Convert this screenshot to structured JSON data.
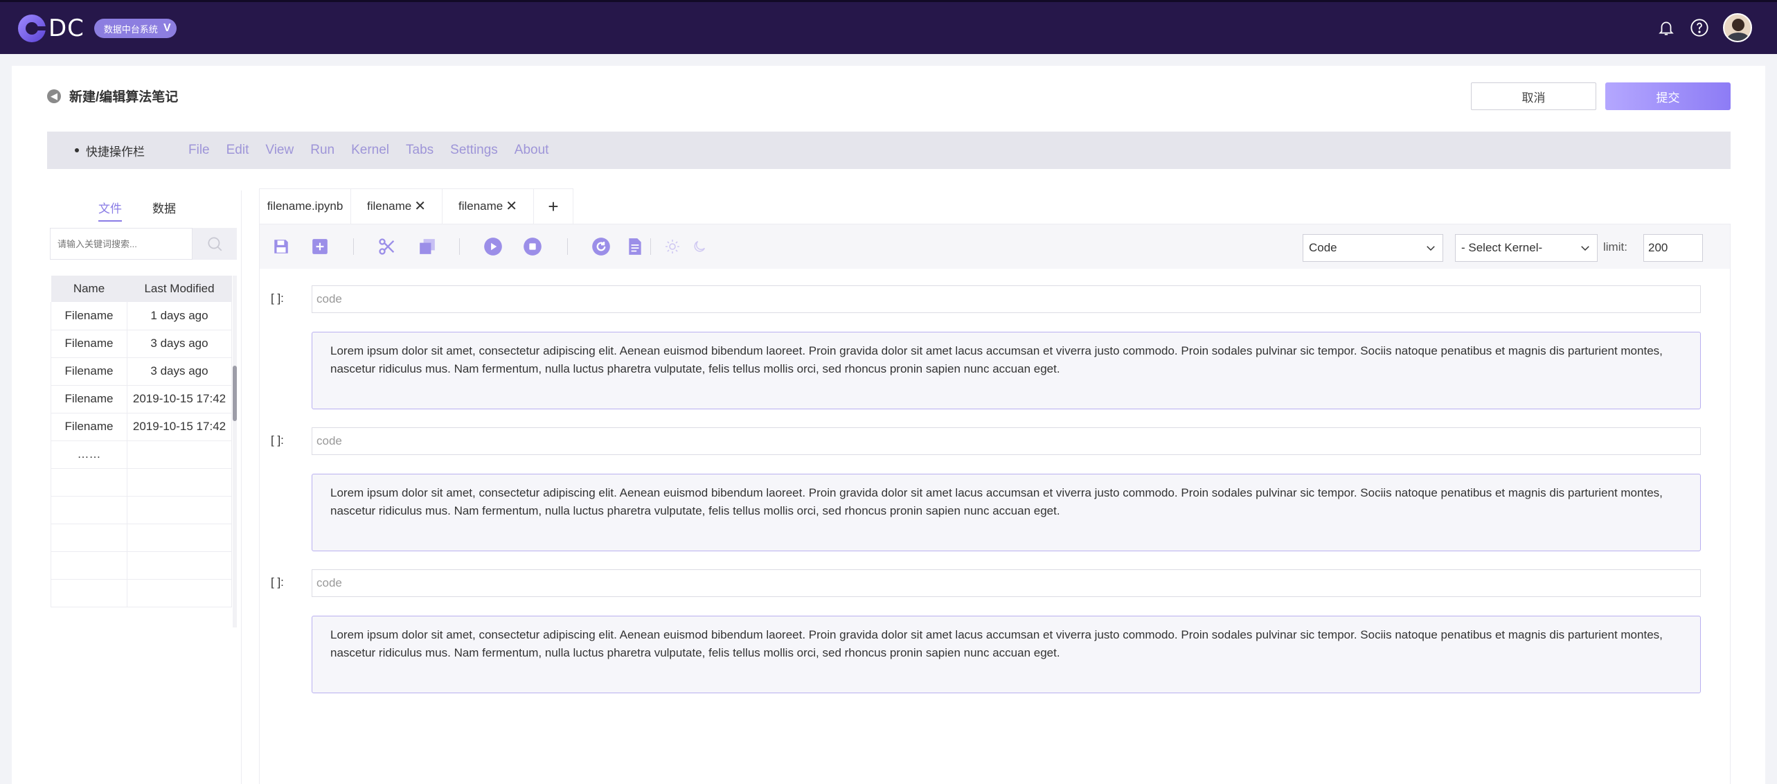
{
  "header": {
    "logo_text": "DC",
    "system_label": "数据中台系统",
    "icons": [
      "bell-icon",
      "help-icon",
      "avatar"
    ]
  },
  "page": {
    "title": "新建/编辑算法笔记",
    "cancel_label": "取消",
    "submit_label": "提交"
  },
  "quickbar": {
    "label": "快捷操作栏",
    "menu": [
      "File",
      "Edit",
      "View",
      "Run",
      "Kernel",
      "Tabs",
      "Settings",
      "About"
    ]
  },
  "left_panel": {
    "tabs": [
      "文件",
      "数据"
    ],
    "active_tab": "文件",
    "search_placeholder": "请输入关键词搜索...",
    "columns": [
      "Name",
      "Last Modified"
    ],
    "rows": [
      [
        "Filename",
        "1 days ago"
      ],
      [
        "Filename",
        "3 days ago"
      ],
      [
        "Filename",
        "3 days ago"
      ],
      [
        "Filename",
        "2019-10-15 17:42"
      ],
      [
        "Filename",
        "2019-10-15 17:42"
      ],
      [
        "……",
        ""
      ],
      [
        "",
        ""
      ],
      [
        "",
        ""
      ],
      [
        "",
        ""
      ],
      [
        "",
        ""
      ],
      [
        "",
        ""
      ]
    ]
  },
  "file_tabs": [
    {
      "label": "filename.ipynb",
      "closable": false
    },
    {
      "label": "filename",
      "closable": true
    },
    {
      "label": "filename",
      "closable": true
    }
  ],
  "toolbar": {
    "icons": [
      "save-icon",
      "add-cell-icon",
      "cut-icon",
      "copy-icon",
      "run-icon",
      "stop-icon",
      "restart-icon",
      "document-icon",
      "light-mode-icon",
      "dark-mode-icon"
    ],
    "cell_type": "Code",
    "kernel": "- Select Kernel-",
    "limit_label": "limit:",
    "limit_value": "200"
  },
  "cells": [
    {
      "prompt": "[ ]:",
      "code_placeholder": "code",
      "output": "Lorem ipsum dolor sit amet, consectetur adipiscing elit. Aenean euismod bibendum laoreet. Proin gravida dolor sit amet lacus accumsan et viverra justo commodo. Proin sodales pulvinar sic tempor. Sociis natoque penatibus et magnis dis parturient montes, nascetur ridiculus mus. Nam fermentum, nulla luctus pharetra vulputate, felis tellus mollis orci, sed rhoncus pronin sapien nunc accuan eget."
    },
    {
      "prompt": "[ ]:",
      "code_placeholder": "code",
      "output": "Lorem ipsum dolor sit amet, consectetur adipiscing elit. Aenean euismod bibendum laoreet. Proin gravida dolor sit amet lacus accumsan et viverra justo commodo. Proin sodales pulvinar sic tempor. Sociis natoque penatibus et magnis dis parturient montes, nascetur ridiculus mus. Nam fermentum, nulla luctus pharetra vulputate, felis tellus mollis orci, sed rhoncus pronin sapien nunc accuan eget."
    },
    {
      "prompt": "[ ]:",
      "code_placeholder": "code",
      "output": "Lorem ipsum dolor sit amet, consectetur adipiscing elit. Aenean euismod bibendum laoreet. Proin gravida dolor sit amet lacus accumsan et viverra justo commodo. Proin sodales pulvinar sic tempor. Sociis natoque penatibus et magnis dis parturient montes, nascetur ridiculus mus. Nam fermentum, nulla luctus pharetra vulputate, felis tellus mollis orci, sed rhoncus pronin sapien nunc accuan eget."
    }
  ],
  "colors": {
    "topbar": "#26174a",
    "accent": "#8a7ce6",
    "menu_text": "#9e95d8"
  }
}
